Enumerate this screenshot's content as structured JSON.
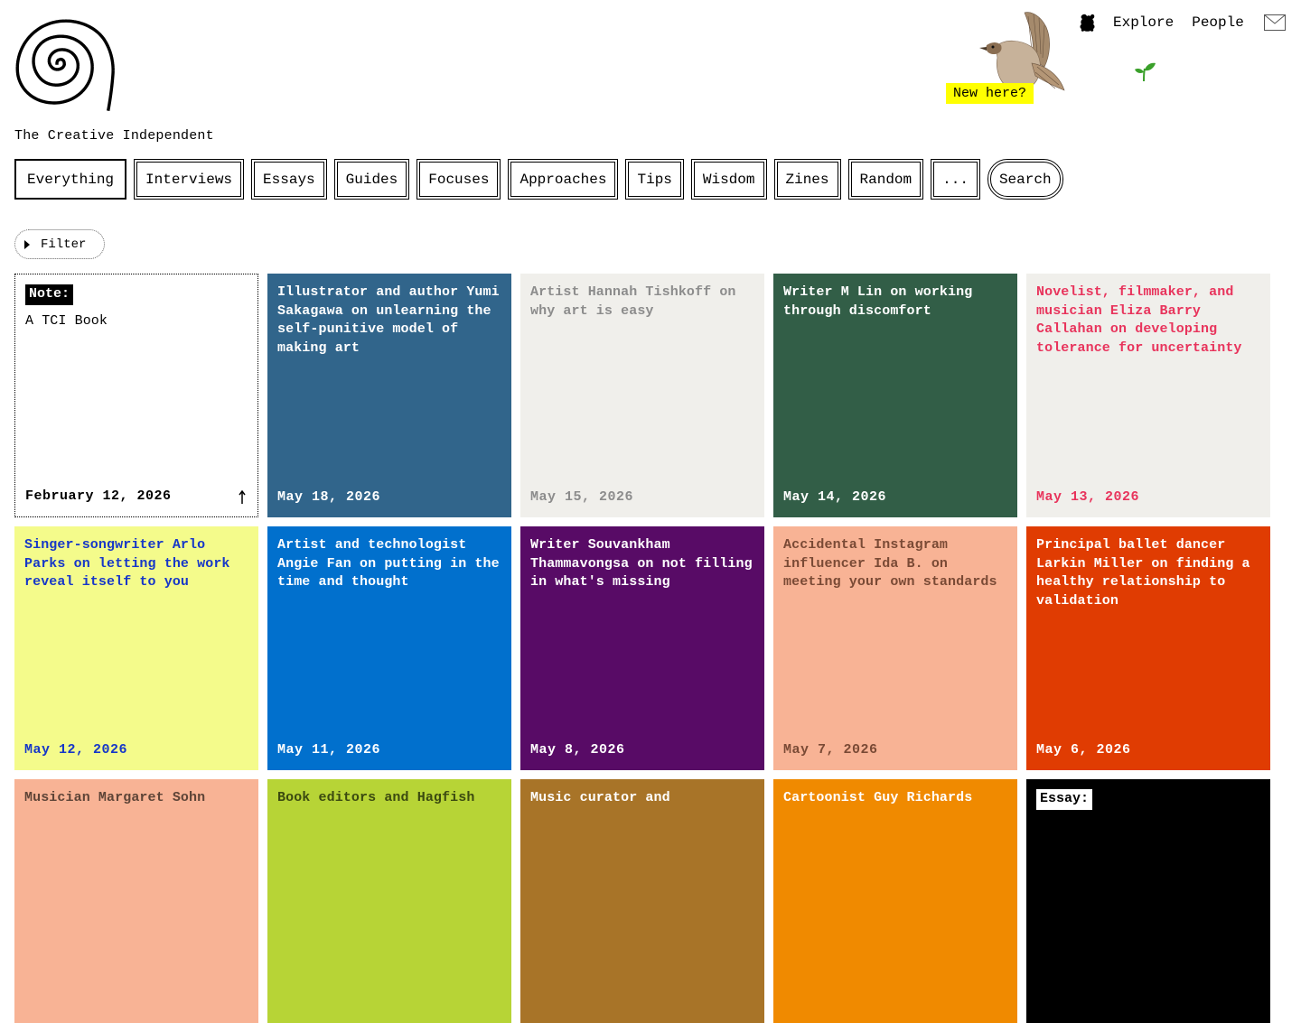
{
  "site": {
    "title": "The Creative Independent",
    "new_here": "New here?"
  },
  "topnav": {
    "explore": "Explore",
    "people": "People"
  },
  "tabs": [
    {
      "label": "Everything"
    },
    {
      "label": "Interviews"
    },
    {
      "label": "Essays"
    },
    {
      "label": "Guides"
    },
    {
      "label": "Focuses"
    },
    {
      "label": "Approaches"
    },
    {
      "label": "Tips"
    },
    {
      "label": "Wisdom"
    },
    {
      "label": "Zines"
    },
    {
      "label": "Random"
    },
    {
      "label": "..."
    },
    {
      "label": "Search"
    }
  ],
  "filter": {
    "label": "Filter"
  },
  "cards": [
    {
      "badge": "Note:",
      "title": "A TCI Book",
      "date": "February 12, 2026",
      "bg": "#ffffff",
      "fg": "#000000"
    },
    {
      "title": "Illustrator and author Yumi Sakagawa on unlearning the self-punitive model of making art",
      "date": "May 18, 2026",
      "bg": "#31658b",
      "fg": "#ffffff"
    },
    {
      "title": "Artist Hannah Tishkoff on why art is easy",
      "date": "May 15, 2026",
      "bg": "#f0efeb",
      "fg": "#8c8c8c"
    },
    {
      "title": "Writer M Lin on working through discomfort",
      "date": "May 14, 2026",
      "bg": "#325e47",
      "fg": "#ffffff"
    },
    {
      "title": "Novelist, filmmaker, and musician Eliza Barry Callahan on developing tolerance for uncertainty",
      "date": "May 13, 2026",
      "bg": "#f0efeb",
      "fg": "#e8345c"
    },
    {
      "title": "Singer-songwriter Arlo Parks on letting the work reveal itself to you",
      "date": "May 12, 2026",
      "bg": "#f4fb8b",
      "fg": "#1637c8"
    },
    {
      "title": "Artist and technologist Angie Fan on putting in the time and thought",
      "date": "May 11, 2026",
      "bg": "#0170cd",
      "fg": "#ffffff"
    },
    {
      "title": "Writer Souvankham Thammavongsa on not filling in what's missing",
      "date": "May 8, 2026",
      "bg": "#580b66",
      "fg": "#ffffff"
    },
    {
      "title": "Accidental Instagram influencer Ida B. on meeting your own standards",
      "date": "May 7, 2026",
      "bg": "#f8b395",
      "fg": "#7a4a35"
    },
    {
      "title": "Principal ballet dancer Larkin Miller on finding a healthy relationship to validation",
      "date": "May 6, 2026",
      "bg": "#e03c02",
      "fg": "#ffffff"
    },
    {
      "title": "Musician Margaret Sohn",
      "date": "",
      "bg": "#f8b395",
      "fg": "#5e4437"
    },
    {
      "title": "Book editors and Hagfish",
      "date": "",
      "bg": "#b7d436",
      "fg": "#3b4a10"
    },
    {
      "title": "Music curator and",
      "date": "",
      "bg": "#a87428",
      "fg": "#ffffff"
    },
    {
      "title": "Cartoonist Guy Richards",
      "date": "",
      "bg": "#f08a00",
      "fg": "#ffffff"
    },
    {
      "badge": "Essay:",
      "title": "",
      "date": "",
      "bg": "#000000",
      "fg": "#ffffff",
      "inverse_badge": true
    }
  ]
}
